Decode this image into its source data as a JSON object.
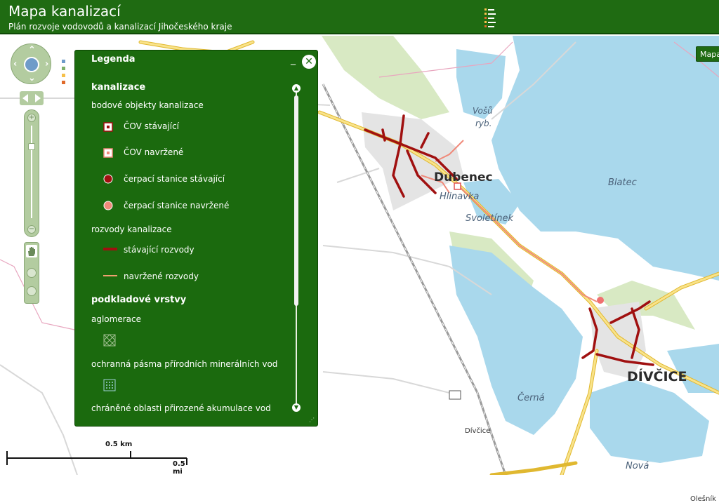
{
  "header": {
    "title": "Mapa kanalizací",
    "subtitle": "Plán rozvoje vodovodů a kanalizací Jihočeského kraje",
    "menu_icon": "list-menu-icon"
  },
  "map": {
    "labels": {
      "dubenec": "Dubenec",
      "hlinavka": "Hlinavka",
      "svoletinek": "Svoletínek",
      "vosu": "Vošů",
      "ryb": "ryb.",
      "blatec": "Blatec",
      "divcice": "DÍVČICE",
      "cerna": "Černá",
      "divcice_station": "Dívčice",
      "nova": "Nová",
      "olesnik": "Olešník"
    },
    "map_button": "Mapa",
    "colors": {
      "water": "#a9d8ec",
      "land": "#ffffff",
      "green": "#d6e8c0",
      "road_main": "#f6d44a",
      "sewer_existing": "#a01010",
      "sewer_planned": "#f08a7a"
    }
  },
  "legend": {
    "title": "Legenda",
    "items": [
      {
        "text": "kanalizace",
        "kind": "heading"
      },
      {
        "text": "bodové objekty kanalizace",
        "kind": "group"
      },
      {
        "text": "ČOV stávající",
        "kind": "item",
        "icon": "cov-existing"
      },
      {
        "text": "ČOV navržené",
        "kind": "item",
        "icon": "cov-planned"
      },
      {
        "text": "čerpací stanice stávající",
        "kind": "item",
        "icon": "pump-existing"
      },
      {
        "text": "čerpací stanice navržené",
        "kind": "item",
        "icon": "pump-planned"
      },
      {
        "text": "rozvody kanalizace",
        "kind": "group"
      },
      {
        "text": "stávající rozvody",
        "kind": "item",
        "icon": "line-existing"
      },
      {
        "text": "navržené rozvody",
        "kind": "item",
        "icon": "line-planned"
      },
      {
        "text": "podkladové vrstvy",
        "kind": "heading"
      },
      {
        "text": "aglomerace",
        "kind": "group"
      },
      {
        "text": "",
        "kind": "swatch",
        "icon": "agglomeration-hatch"
      },
      {
        "text": "ochranná pásma přírodních minerálních vod",
        "kind": "group"
      },
      {
        "text": "",
        "kind": "swatch",
        "icon": "mineral-dots"
      },
      {
        "text": "chráněné oblasti přirozené akumulace vod",
        "kind": "group"
      }
    ]
  },
  "scale": {
    "km_label": "0.5 km",
    "mi_label": "0.5 mi"
  }
}
